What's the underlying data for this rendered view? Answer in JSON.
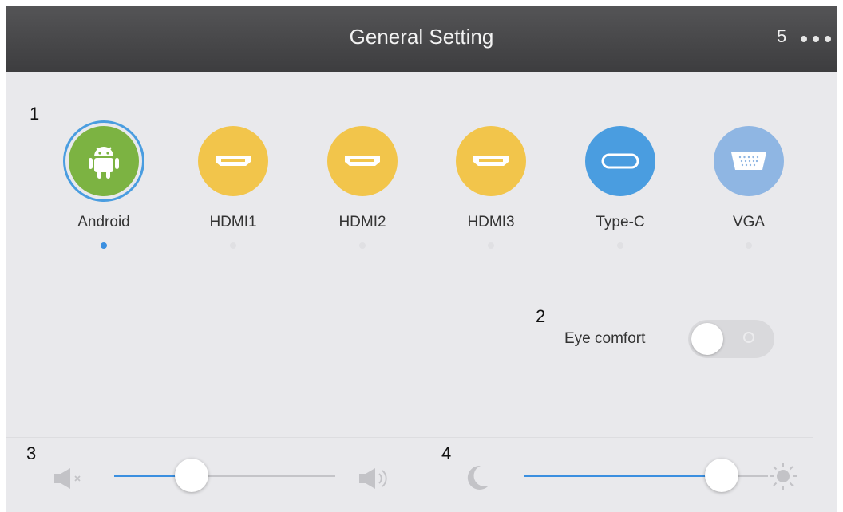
{
  "header": {
    "title": "General Setting",
    "callout_number": "5",
    "more_icon": "more-dots-icon"
  },
  "callouts": {
    "sources": "1",
    "eye_comfort": "2",
    "volume": "3",
    "brightness": "4"
  },
  "sources": [
    {
      "label": "Android",
      "icon": "android-icon",
      "color": "#7cb342",
      "selected": true
    },
    {
      "label": "HDMI1",
      "icon": "hdmi-icon",
      "color": "#f2c54b",
      "selected": false
    },
    {
      "label": "HDMI2",
      "icon": "hdmi-icon",
      "color": "#f2c54b",
      "selected": false
    },
    {
      "label": "HDMI3",
      "icon": "hdmi-icon",
      "color": "#f2c54b",
      "selected": false
    },
    {
      "label": "Type-C",
      "icon": "usb-c-icon",
      "color": "#4a9de0",
      "selected": false
    },
    {
      "label": "VGA",
      "icon": "vga-icon",
      "color": "#8fb6e3",
      "selected": false
    }
  ],
  "eye_comfort": {
    "label": "Eye comfort",
    "enabled": false
  },
  "volume": {
    "level": 0.35,
    "min_icon": "volume-mute-icon",
    "max_icon": "volume-high-icon"
  },
  "brightness": {
    "level": 0.81,
    "min_icon": "moon-icon",
    "max_icon": "sun-icon"
  },
  "colors": {
    "accent": "#3b8fe0",
    "header_bg": "#4a4a4c",
    "panel_bg": "#e9e9ec"
  }
}
